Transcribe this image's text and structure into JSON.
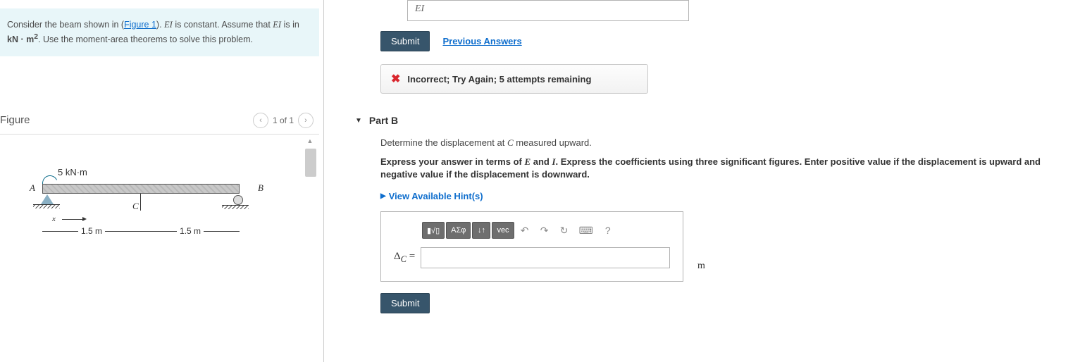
{
  "problem": {
    "text_before_link": "Consider the beam shown in (",
    "figure_link": "Figure 1",
    "text_after_link": "). ",
    "ei_constant": "EI",
    "text_mid": " is constant. Assume that ",
    "ei_var": "EI",
    "text_units1": " is in ",
    "units_bold": "kN · m",
    "units_sup": "2",
    "text_end": ". Use the moment-area theorems to solve this problem."
  },
  "figure": {
    "title": "Figure",
    "nav_text": "1 of 1",
    "moment_label": "5 kN·m",
    "label_A": "A",
    "label_B": "B",
    "label_C": "C",
    "x_label": "x",
    "dim1": "1.5 m",
    "dim2": "1.5 m"
  },
  "partA": {
    "prev_input_display": "EI",
    "submit_label": "Submit",
    "prev_answers_label": "Previous Answers",
    "feedback": "Incorrect; Try Again; 5 attempts remaining"
  },
  "partB": {
    "header": "Part B",
    "question_before": "Determine the displacement at ",
    "question_var": "C",
    "question_after": " measured upward.",
    "instructions_before": "Express your answer in terms of ",
    "instr_E": "E",
    "instr_and": " and ",
    "instr_I": "I",
    "instructions_after": ". Express the coefficients using three significant figures. Enter positive value if the displacement is upward and negative value if the displacement is downward.",
    "hints_label": "View Available Hint(s)",
    "toolbar": {
      "templates": "▮√▯",
      "greek": "ΑΣφ",
      "updown": "↓↑",
      "vec": "vec",
      "undo": "↶",
      "redo": "↷",
      "reset": "↻",
      "keyboard": "⌨",
      "help": "?"
    },
    "answer_label_delta": "Δ",
    "answer_label_sub": "C",
    "answer_label_eq": " =",
    "unit": "m",
    "submit_label": "Submit"
  }
}
